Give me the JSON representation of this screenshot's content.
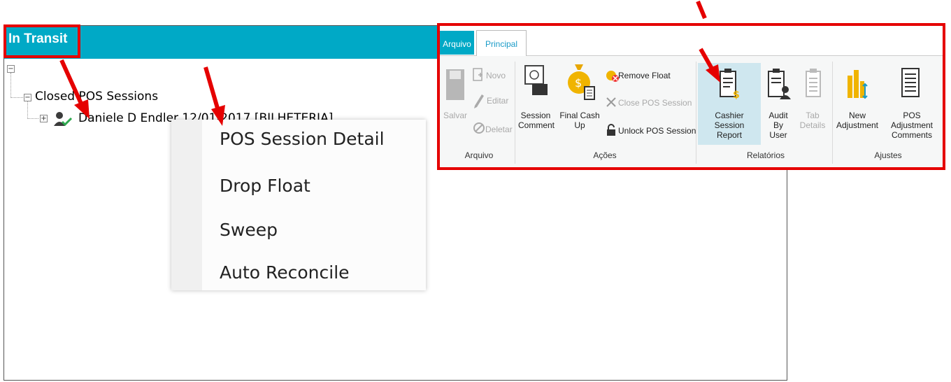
{
  "panel": {
    "title": "In Transit"
  },
  "tree": {
    "root_expander": "−",
    "closed_sessions": {
      "expander": "−",
      "label": "Closed POS Sessions"
    },
    "session_node": {
      "expander": "+",
      "label": "Daniele D Endler 12/01/2017 [BILHETERIA]"
    }
  },
  "context_menu": {
    "items": [
      "POS Session Detail",
      "Drop Float",
      "Sweep",
      "Auto Reconcile"
    ]
  },
  "ribbon": {
    "tabs": {
      "arquivo": "Arquivo",
      "principal": "Principal"
    },
    "arquivo_group": {
      "label": "Arquivo",
      "salvar": "Salvar",
      "novo": "Novo",
      "editar": "Editar",
      "deletar": "Deletar"
    },
    "acoes_group": {
      "label": "Ações",
      "session_comment_1": "Session",
      "session_comment_2": "Comment",
      "final_cash_up_1": "Final Cash",
      "final_cash_up_2": "Up",
      "remove_float": "Remove Float",
      "close_pos_session": "Close POS Session",
      "unlock_pos_session": "Unlock POS Session"
    },
    "relatorios_group": {
      "label": "Relatórios",
      "cashier_1": "Cashier Session",
      "cashier_2": "Report",
      "audit_1": "Audit By",
      "audit_2": "User",
      "tab_1": "Tab",
      "tab_2": "Details"
    },
    "ajustes_group": {
      "label": "Ajustes",
      "new_adj_1": "New",
      "new_adj_2": "Adjustment",
      "pos_adj_1": "POS Adjustment",
      "pos_adj_2": "Comments"
    }
  },
  "colors": {
    "accent": "#00a9c6",
    "highlight_red": "#e50000"
  }
}
